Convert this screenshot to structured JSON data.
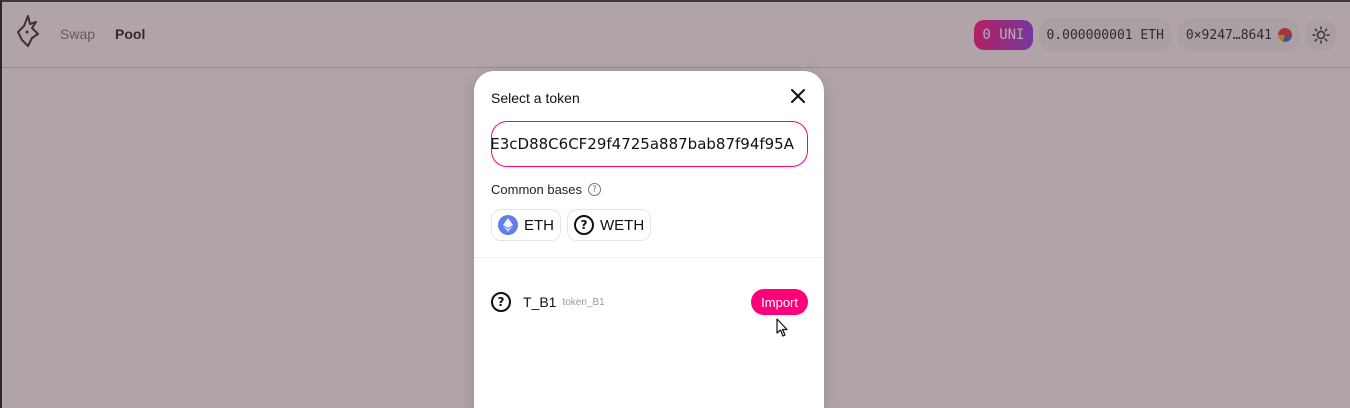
{
  "header": {
    "nav": {
      "swap_label": "Swap",
      "pool_label": "Pool"
    },
    "uni_balance": "0 UNI",
    "eth_balance": "0.000000001 ETH",
    "account_address": "0×9247…8641",
    "theme_icon": "sun-icon",
    "logo_icon": "unicorn-logo-icon"
  },
  "modal": {
    "title": "Select a token",
    "search_value": "E3cD88C6CF29f4725a887bab87f94f95A",
    "common_bases_label": "Common bases",
    "bases": [
      {
        "label": "ETH",
        "icon": "ethereum-icon"
      },
      {
        "label": "WETH",
        "icon": "question-icon"
      }
    ],
    "token": {
      "symbol": "T_B1",
      "name": "token_B1",
      "icon": "question-icon"
    },
    "import_label": "Import"
  },
  "colors": {
    "accent": "#ff007a",
    "uni_gradient_start": "#ff007a",
    "uni_gradient_end": "#8a2be2"
  }
}
